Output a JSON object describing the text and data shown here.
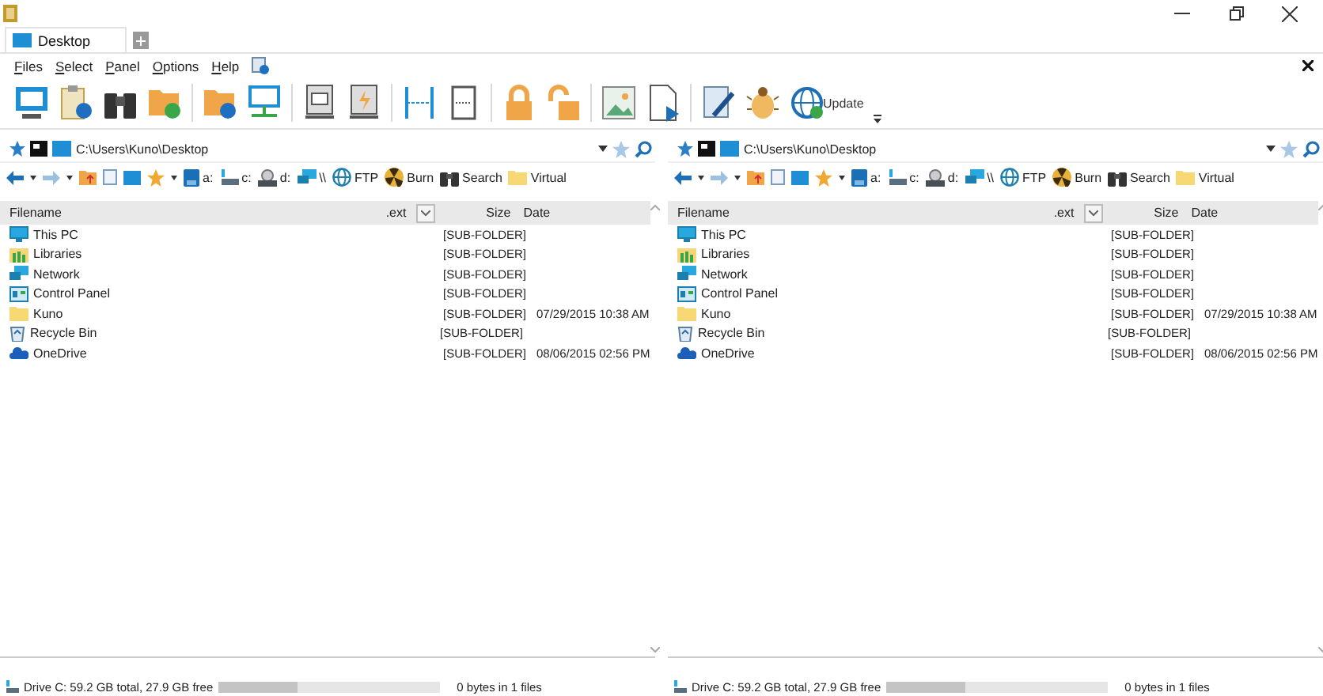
{
  "window": {
    "tab": {
      "label": "Desktop",
      "selected": true
    },
    "menu": [
      "Files",
      "Select",
      "Panel",
      "Options",
      "Help"
    ],
    "toolbar": {
      "update_label": "Update"
    }
  },
  "panels": [
    {
      "path": "C:\\Users\\Kuno\\Desktop",
      "nav": [
        {
          "label": "a:",
          "kind": "floppy"
        },
        {
          "label": "c:",
          "kind": "drive"
        },
        {
          "label": "d:",
          "kind": "cd"
        },
        {
          "label": "\\\\",
          "kind": "network"
        },
        {
          "label": "FTP",
          "kind": "globe"
        },
        {
          "label": "Burn",
          "kind": "burn"
        },
        {
          "label": "Search",
          "kind": "binoculars"
        },
        {
          "label": "Virtual",
          "kind": "folder"
        }
      ],
      "columns": [
        "Filename",
        ".ext",
        "Size",
        "Date"
      ],
      "rows": [
        {
          "name": "This PC",
          "kind": "pc",
          "size": "[SUB-FOLDER]",
          "date": ""
        },
        {
          "name": "Libraries",
          "kind": "library",
          "size": "[SUB-FOLDER]",
          "date": ""
        },
        {
          "name": "Network",
          "kind": "network",
          "size": "[SUB-FOLDER]",
          "date": ""
        },
        {
          "name": "Control Panel",
          "kind": "control",
          "size": "[SUB-FOLDER]",
          "date": ""
        },
        {
          "name": "Kuno",
          "kind": "folder",
          "size": "[SUB-FOLDER]",
          "date": "07/29/2015 10:38 AM"
        },
        {
          "name": "Recycle Bin",
          "kind": "recycle",
          "size": "[SUB-FOLDER]",
          "date": ""
        },
        {
          "name": "OneDrive",
          "kind": "cloud",
          "size": "[SUB-FOLDER]",
          "date": "08/06/2015 02:56 PM"
        }
      ],
      "status": {
        "drive": "Drive C: 59.2 GB total, 27.9 GB free",
        "level": 0.36,
        "selection": "0 bytes in 1 files"
      }
    },
    {
      "path": "C:\\Users\\Kuno\\Desktop",
      "nav": [
        {
          "label": "a:",
          "kind": "floppy"
        },
        {
          "label": "c:",
          "kind": "drive"
        },
        {
          "label": "d:",
          "kind": "cd"
        },
        {
          "label": "\\\\",
          "kind": "network"
        },
        {
          "label": "FTP",
          "kind": "globe"
        },
        {
          "label": "Burn",
          "kind": "burn"
        },
        {
          "label": "Search",
          "kind": "binoculars"
        },
        {
          "label": "Virtual",
          "kind": "folder"
        }
      ],
      "columns": [
        "Filename",
        ".ext",
        "Size",
        "Date"
      ],
      "rows": [
        {
          "name": "This PC",
          "kind": "pc",
          "size": "[SUB-FOLDER]",
          "date": ""
        },
        {
          "name": "Libraries",
          "kind": "library",
          "size": "[SUB-FOLDER]",
          "date": ""
        },
        {
          "name": "Network",
          "kind": "network",
          "size": "[SUB-FOLDER]",
          "date": ""
        },
        {
          "name": "Control Panel",
          "kind": "control",
          "size": "[SUB-FOLDER]",
          "date": ""
        },
        {
          "name": "Kuno",
          "kind": "folder",
          "size": "[SUB-FOLDER]",
          "date": "07/29/2015 10:38 AM"
        },
        {
          "name": "Recycle Bin",
          "kind": "recycle",
          "size": "[SUB-FOLDER]",
          "date": ""
        },
        {
          "name": "OneDrive",
          "kind": "cloud",
          "size": "[SUB-FOLDER]",
          "date": "08/06/2015 02:56 PM"
        }
      ],
      "status": {
        "drive": "Drive C: 59.2 GB total, 27.9 GB free",
        "level": 0.36,
        "selection": "0 bytes in 1 files"
      }
    }
  ]
}
